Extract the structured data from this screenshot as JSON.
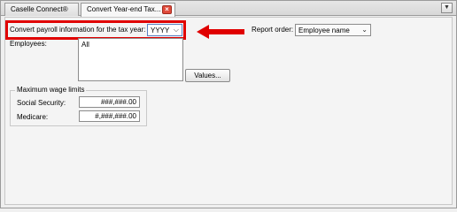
{
  "tabs": [
    {
      "label": "Caselle Connect®",
      "active": false
    },
    {
      "label": "Convert Year-end Tax...",
      "active": true
    }
  ],
  "form": {
    "tax_year_label": "Convert payroll information for the tax year:",
    "tax_year_value": "YYYY",
    "report_order_label": "Report order:",
    "report_order_value": "Employee name",
    "employees_label": "Employees:",
    "employees_list": [
      "All"
    ],
    "values_button": "Values...",
    "max_wage_title": "Maximum wage limits",
    "social_security_label": "Social Security:",
    "social_security_value": "###,###.00",
    "medicare_label": "Medicare:",
    "medicare_value": "#,###,###.00"
  },
  "colors": {
    "highlight": "#e00000",
    "arrow": "#e00000"
  },
  "icons": {
    "tab_close": "close-icon",
    "tab_menu": "chevron-down-icon",
    "combo_arrow": "chevron-down-icon",
    "annotation": "arrow-left-icon"
  }
}
